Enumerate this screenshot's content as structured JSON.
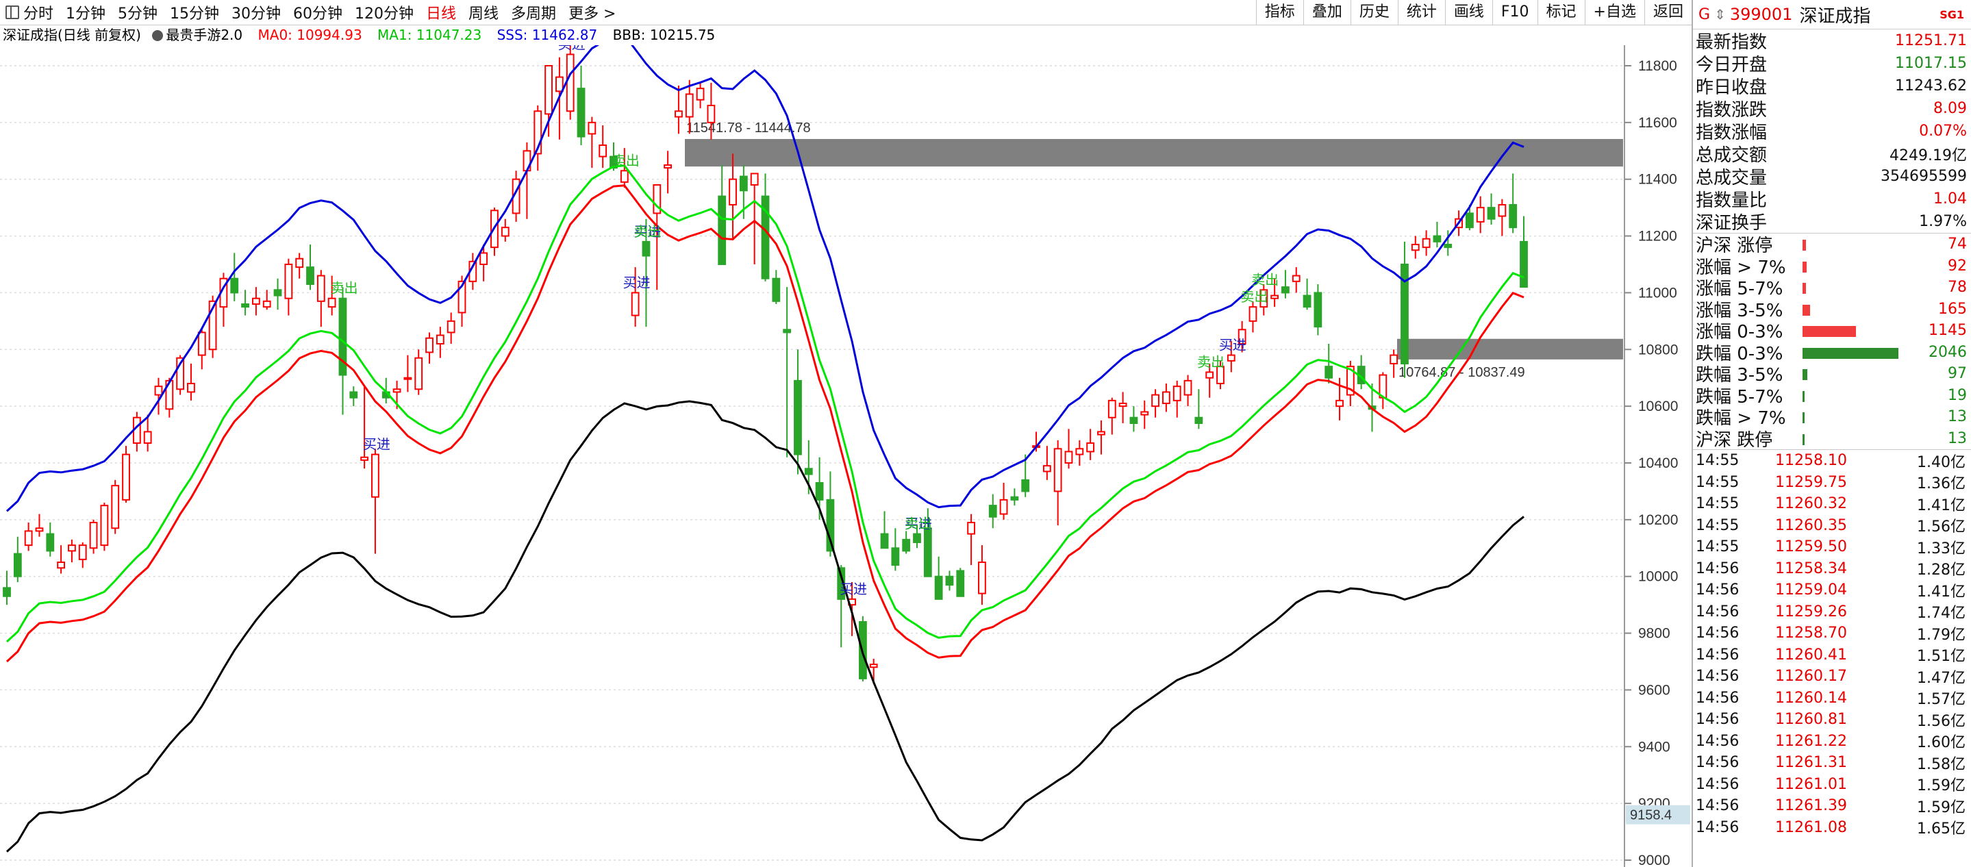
{
  "toolbar": {
    "periods": [
      "分时",
      "1分钟",
      "5分钟",
      "15分钟",
      "30分钟",
      "60分钟",
      "120分钟",
      "日线",
      "周线",
      "多周期",
      "更多 >"
    ],
    "active_period": "日线",
    "buttons": [
      "指标",
      "叠加",
      "历史",
      "统计",
      "画线",
      "F10",
      "标记",
      "+自选",
      "返回"
    ]
  },
  "infobar": {
    "title": "深证成指(日线 前复权)",
    "indicator": "最贵手游2.0",
    "ma0": "MA0: 10994.93",
    "ma1": "MA1: 11047.23",
    "sss": "SSS: 11462.87",
    "bbb": "BBB: 10215.75"
  },
  "colors": {
    "up": "#ff0000",
    "down": "#2aa52a",
    "ma0": "#ff0000",
    "ma1": "#00e600",
    "sss": "#0000dd",
    "bbb": "#000000",
    "zone": "#808080"
  },
  "chart_data": {
    "type": "candlestick",
    "y_ticks": [
      "11800",
      "11600",
      "11400",
      "11200",
      "11000",
      "10800",
      "10600",
      "10400",
      "10200",
      "10000",
      "9800",
      "9600",
      "9400",
      "9200",
      "9000"
    ],
    "current_label": "9158.4",
    "zones": [
      {
        "label": "11541.78 - 11444.78",
        "high": 11541.78,
        "low": 11444.78
      },
      {
        "label": "10764.87 - 10837.49",
        "high": 10837.49,
        "low": 10764.87
      }
    ],
    "signals": [
      {
        "text": "卖出",
        "kind": "sell",
        "i": 31
      },
      {
        "text": "买进",
        "kind": "buy",
        "i": 34
      },
      {
        "text": "买进",
        "kind": "buy",
        "i": 52
      },
      {
        "text": "卖出",
        "kind": "sell",
        "i": 57
      },
      {
        "text": "买进",
        "kind": "buy",
        "i": 58
      },
      {
        "text": "买进",
        "kind": "buy",
        "i": 59
      },
      {
        "text": "卖出",
        "kind": "sell",
        "i": 59
      },
      {
        "text": "买进",
        "kind": "buy",
        "i": 78
      },
      {
        "text": "买进",
        "kind": "buy",
        "i": 84
      },
      {
        "text": "卖出",
        "kind": "sell",
        "i": 84
      },
      {
        "text": "卖出",
        "kind": "sell",
        "i": 111
      },
      {
        "text": "买进",
        "kind": "buy",
        "i": 113
      },
      {
        "text": "卖出",
        "kind": "sell",
        "i": 115
      },
      {
        "text": "卖出",
        "kind": "sell",
        "i": 116
      }
    ],
    "candles": [
      [
        9960,
        10020,
        9900,
        9930
      ],
      [
        10080,
        10140,
        9980,
        10000
      ],
      [
        10110,
        10190,
        10090,
        10160
      ],
      [
        10160,
        10220,
        10140,
        10170
      ],
      [
        10150,
        10190,
        10070,
        10090
      ],
      [
        10030,
        10110,
        10010,
        10050
      ],
      [
        10090,
        10130,
        10050,
        10110
      ],
      [
        10060,
        10120,
        10030,
        10110
      ],
      [
        10100,
        10200,
        10080,
        10190
      ],
      [
        10110,
        10260,
        10090,
        10250
      ],
      [
        10170,
        10340,
        10150,
        10320
      ],
      [
        10270,
        10460,
        10260,
        10430
      ],
      [
        10470,
        10580,
        10440,
        10560
      ],
      [
        10470,
        10570,
        10440,
        10510
      ],
      [
        10640,
        10700,
        10570,
        10670
      ],
      [
        10590,
        10700,
        10560,
        10690
      ],
      [
        10660,
        10780,
        10640,
        10770
      ],
      [
        10650,
        10750,
        10620,
        10680
      ],
      [
        10780,
        10870,
        10730,
        10860
      ],
      [
        10800,
        10990,
        10770,
        10970
      ],
      [
        10950,
        11070,
        10880,
        11050
      ],
      [
        11050,
        11140,
        10970,
        11000
      ],
      [
        10960,
        11010,
        10920,
        10950
      ],
      [
        10960,
        11020,
        10920,
        10980
      ],
      [
        10950,
        11010,
        10940,
        10970
      ],
      [
        11010,
        11050,
        10940,
        10990
      ],
      [
        10980,
        11120,
        10920,
        11100
      ],
      [
        11090,
        11140,
        11050,
        11120
      ],
      [
        11090,
        11170,
        11010,
        11030
      ],
      [
        10970,
        11080,
        10880,
        11060
      ],
      [
        10950,
        11060,
        10920,
        10980
      ],
      [
        10980,
        11020,
        10570,
        10710
      ],
      [
        10650,
        10670,
        10600,
        10630
      ],
      [
        10410,
        10670,
        10380,
        10420
      ],
      [
        10280,
        10450,
        10080,
        10430
      ],
      [
        10650,
        10700,
        10610,
        10630
      ],
      [
        10650,
        10690,
        10590,
        10660
      ],
      [
        10700,
        10780,
        10650,
        10700
      ],
      [
        10660,
        10800,
        10640,
        10770
      ],
      [
        10790,
        10860,
        10750,
        10840
      ],
      [
        10820,
        10880,
        10770,
        10850
      ],
      [
        10860,
        10930,
        10820,
        10900
      ],
      [
        10930,
        11060,
        10880,
        11040
      ],
      [
        11040,
        11140,
        11010,
        11110
      ],
      [
        11100,
        11170,
        11040,
        11140
      ],
      [
        11160,
        11300,
        11130,
        11290
      ],
      [
        11200,
        11260,
        11180,
        11230
      ],
      [
        11280,
        11430,
        11250,
        11400
      ],
      [
        11430,
        11530,
        11260,
        11500
      ],
      [
        11490,
        11660,
        11430,
        11640
      ],
      [
        11630,
        11780,
        11550,
        11800
      ],
      [
        11710,
        11830,
        11540,
        11760
      ],
      [
        11640,
        11880,
        11610,
        11840
      ],
      [
        11720,
        11800,
        11520,
        11550
      ],
      [
        11560,
        11620,
        11440,
        11600
      ],
      [
        11480,
        11590,
        11440,
        11520
      ],
      [
        11480,
        11530,
        11430,
        11440
      ],
      [
        11390,
        11510,
        11370,
        11430
      ],
      [
        10920,
        11090,
        10880,
        11000
      ],
      [
        11180,
        11260,
        10880,
        11130
      ],
      [
        11280,
        11310,
        11010,
        11380
      ],
      [
        11440,
        11500,
        11350,
        11450
      ],
      [
        11620,
        11730,
        11560,
        11640
      ],
      [
        11620,
        11750,
        11560,
        11700
      ],
      [
        11680,
        11740,
        11650,
        11720
      ],
      [
        11600,
        11740,
        11540,
        11660
      ],
      [
        11340,
        11450,
        11280,
        11100
      ],
      [
        11310,
        11490,
        11190,
        11400
      ],
      [
        11410,
        11450,
        11260,
        11360
      ],
      [
        11380,
        11400,
        11100,
        11420
      ],
      [
        11340,
        11420,
        11040,
        11050
      ],
      [
        11050,
        11080,
        10960,
        10970
      ],
      [
        10870,
        11020,
        10420,
        10860
      ],
      [
        10690,
        10800,
        10360,
        10430
      ],
      [
        10380,
        10480,
        10290,
        10360
      ],
      [
        10330,
        10420,
        10200,
        10270
      ],
      [
        10270,
        10370,
        10070,
        10090
      ],
      [
        10030,
        10040,
        9750,
        9920
      ],
      [
        9900,
        9980,
        9790,
        9920
      ],
      [
        9840,
        9860,
        9630,
        9640
      ],
      [
        9680,
        9710,
        9620,
        9690
      ],
      [
        10150,
        10230,
        10140,
        10100
      ],
      [
        10100,
        10170,
        10020,
        10040
      ],
      [
        10130,
        10160,
        10080,
        10090
      ],
      [
        10150,
        10180,
        10100,
        10120
      ],
      [
        10170,
        10240,
        10030,
        10000
      ],
      [
        10000,
        10070,
        9970,
        9920
      ],
      [
        10000,
        10020,
        9950,
        9970
      ],
      [
        10020,
        10030,
        9950,
        9930
      ],
      [
        10150,
        10220,
        10040,
        10190
      ],
      [
        9940,
        10110,
        9900,
        10050
      ],
      [
        10250,
        10290,
        10170,
        10210
      ],
      [
        10220,
        10330,
        10200,
        10270
      ],
      [
        10280,
        10310,
        10250,
        10270
      ],
      [
        10340,
        10430,
        10280,
        10300
      ],
      [
        10460,
        10510,
        10440,
        10460
      ],
      [
        10370,
        10460,
        10340,
        10390
      ],
      [
        10300,
        10480,
        10180,
        10450
      ],
      [
        10400,
        10520,
        10380,
        10440
      ],
      [
        10430,
        10480,
        10390,
        10450
      ],
      [
        10440,
        10520,
        10410,
        10470
      ],
      [
        10500,
        10550,
        10430,
        10510
      ],
      [
        10560,
        10630,
        10500,
        10620
      ],
      [
        10600,
        10650,
        10540,
        10610
      ],
      [
        10560,
        10600,
        10510,
        10540
      ],
      [
        10570,
        10620,
        10520,
        10580
      ],
      [
        10600,
        10660,
        10560,
        10640
      ],
      [
        10610,
        10680,
        10580,
        10650
      ],
      [
        10620,
        10690,
        10560,
        10670
      ],
      [
        10640,
        10710,
        10600,
        10690
      ],
      [
        10560,
        10660,
        10520,
        10540
      ],
      [
        10700,
        10750,
        10630,
        10720
      ],
      [
        10680,
        10760,
        10660,
        10740
      ],
      [
        10760,
        10830,
        10720,
        10780
      ],
      [
        10820,
        10900,
        10790,
        10870
      ],
      [
        10900,
        10970,
        10860,
        10950
      ],
      [
        10950,
        11030,
        10920,
        11010
      ],
      [
        10980,
        11050,
        10950,
        10990
      ],
      [
        11020,
        11080,
        10980,
        11000
      ],
      [
        11040,
        11090,
        11000,
        11060
      ],
      [
        10990,
        11050,
        10940,
        10950
      ],
      [
        11000,
        11030,
        10850,
        10880
      ],
      [
        10740,
        10820,
        10680,
        10700
      ],
      [
        10600,
        10700,
        10550,
        10620
      ],
      [
        10640,
        10760,
        10600,
        10740
      ],
      [
        10740,
        10780,
        10660,
        10680
      ],
      [
        10600,
        10680,
        10510,
        10590
      ],
      [
        10630,
        10720,
        10590,
        10710
      ],
      [
        10750,
        10800,
        10700,
        10780
      ],
      [
        11100,
        11180,
        10700,
        10750
      ],
      [
        11150,
        11200,
        11120,
        11170
      ],
      [
        11160,
        11220,
        11130,
        11190
      ],
      [
        11200,
        11250,
        11160,
        11180
      ],
      [
        11170,
        11220,
        11130,
        11160
      ],
      [
        11230,
        11290,
        11200,
        11260
      ],
      [
        11280,
        11310,
        11220,
        11230
      ],
      [
        11250,
        11340,
        11210,
        11300
      ],
      [
        11300,
        11350,
        11240,
        11260
      ],
      [
        11270,
        11330,
        11200,
        11310
      ],
      [
        11310,
        11420,
        11210,
        11230
      ],
      [
        11180,
        11270,
        11040,
        11020
      ]
    ]
  },
  "panel": {
    "header": {
      "g": "G",
      "arrow": "⇕",
      "code": "399001",
      "name": "深证成指",
      "tag": "SG1"
    },
    "quote": [
      {
        "label": "最新指数",
        "value": "11251.71",
        "color": "red"
      },
      {
        "label": "今日开盘",
        "value": "11017.15",
        "color": "green"
      },
      {
        "label": "昨日收盘",
        "value": "11243.62",
        "color": "black"
      },
      {
        "label": "指数涨跌",
        "value": "8.09",
        "color": "red"
      },
      {
        "label": "指数涨幅",
        "value": "0.07%",
        "color": "red"
      },
      {
        "label": "总成交额",
        "value": "4249.19亿",
        "color": "black"
      },
      {
        "label": "总成交量",
        "value": "354695599",
        "color": "black"
      },
      {
        "label": "指数量比",
        "value": "1.04",
        "color": "red"
      },
      {
        "label": "深证换手",
        "value": "1.97%",
        "color": "black"
      }
    ],
    "breadth": [
      {
        "label": "沪深 涨停",
        "value": "74",
        "side": "up",
        "level": 0.035
      },
      {
        "label": "涨幅 > 7%",
        "value": "92",
        "side": "up",
        "level": 0.045
      },
      {
        "label": "涨幅 5-7%",
        "value": "78",
        "side": "up",
        "level": 0.038
      },
      {
        "label": "涨幅 3-5%",
        "value": "165",
        "side": "up",
        "level": 0.081
      },
      {
        "label": "涨幅 0-3%",
        "value": "1145",
        "side": "up",
        "level": 0.56
      },
      {
        "label": "跌幅 0-3%",
        "value": "2046",
        "side": "down",
        "level": 1.0
      },
      {
        "label": "跌幅 3-5%",
        "value": "97",
        "side": "down",
        "level": 0.047
      },
      {
        "label": "跌幅 5-7%",
        "value": "19",
        "side": "down",
        "level": 0.009
      },
      {
        "label": "跌幅 > 7%",
        "value": "13",
        "side": "down",
        "level": 0.006
      },
      {
        "label": "沪深 跌停",
        "value": "13",
        "side": "down",
        "level": 0.006
      }
    ],
    "ticks": [
      {
        "t": "14:55",
        "p": "11258.10",
        "v": "1.40亿"
      },
      {
        "t": "14:55",
        "p": "11259.75",
        "v": "1.36亿"
      },
      {
        "t": "14:55",
        "p": "11260.32",
        "v": "1.41亿"
      },
      {
        "t": "14:55",
        "p": "11260.35",
        "v": "1.56亿"
      },
      {
        "t": "14:55",
        "p": "11259.50",
        "v": "1.33亿"
      },
      {
        "t": "14:56",
        "p": "11258.34",
        "v": "1.28亿"
      },
      {
        "t": "14:56",
        "p": "11259.04",
        "v": "1.41亿"
      },
      {
        "t": "14:56",
        "p": "11259.26",
        "v": "1.74亿"
      },
      {
        "t": "14:56",
        "p": "11258.70",
        "v": "1.79亿"
      },
      {
        "t": "14:56",
        "p": "11260.41",
        "v": "1.51亿"
      },
      {
        "t": "14:56",
        "p": "11260.17",
        "v": "1.47亿"
      },
      {
        "t": "14:56",
        "p": "11260.14",
        "v": "1.57亿"
      },
      {
        "t": "14:56",
        "p": "11260.81",
        "v": "1.56亿"
      },
      {
        "t": "14:56",
        "p": "11261.22",
        "v": "1.60亿"
      },
      {
        "t": "14:56",
        "p": "11261.31",
        "v": "1.58亿"
      },
      {
        "t": "14:56",
        "p": "11261.01",
        "v": "1.59亿"
      },
      {
        "t": "14:56",
        "p": "11261.39",
        "v": "1.59亿"
      },
      {
        "t": "14:56",
        "p": "11261.08",
        "v": "1.65亿"
      }
    ]
  }
}
